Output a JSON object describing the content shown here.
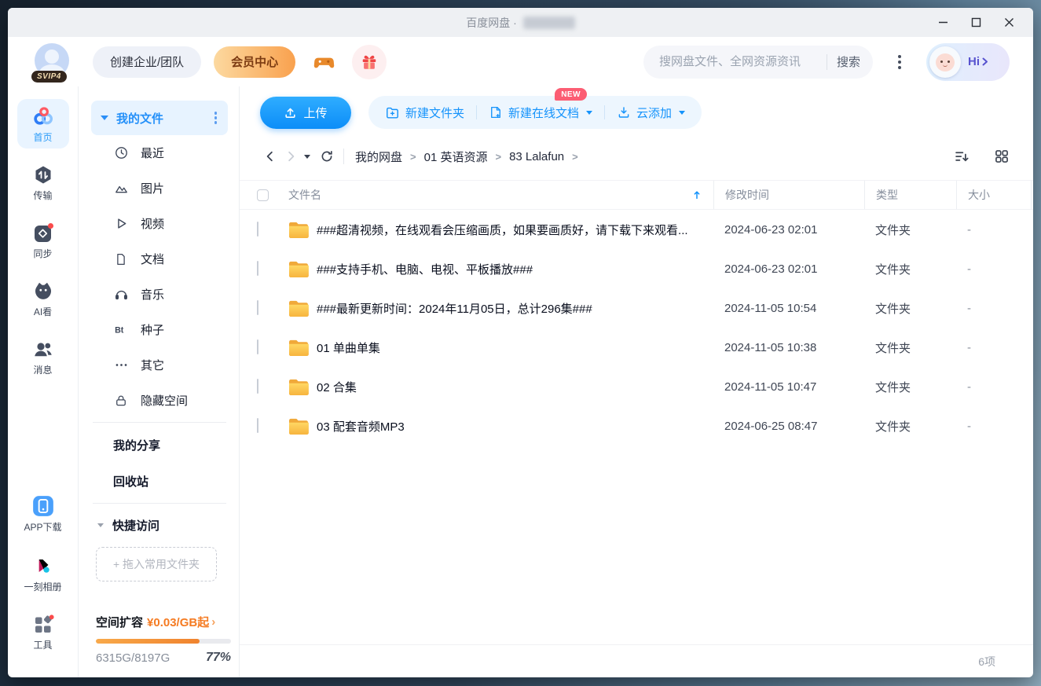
{
  "colors": {
    "accent": "#0f9bfb",
    "accent_light_bg": "#e9f4ff",
    "toolbar_group_bg": "#edf6fe",
    "orange": "#f57b22",
    "new_badge": "#fc5d73",
    "member_gradient_start": "#fcd9a0",
    "member_gradient_end": "#f9a14e",
    "folder_yellow": "#fbc64e"
  },
  "titlebar": {
    "title": "百度网盘 ·"
  },
  "header": {
    "vip_badge": "SVIP4",
    "create_team_label": "创建企业/团队",
    "member_center_label": "会员中心",
    "search_placeholder": "搜网盘文件、全网资源资讯",
    "search_button_label": "搜索",
    "greeting": "Hi"
  },
  "nav_rail": {
    "items": [
      {
        "label": "首页",
        "icon": "netdisk-logo-icon",
        "active": true
      },
      {
        "label": "传输",
        "icon": "transfer-icon"
      },
      {
        "label": "同步",
        "icon": "sync-icon"
      },
      {
        "label": "AI看",
        "icon": "ai-view-icon"
      },
      {
        "label": "消息",
        "icon": "messages-icon"
      }
    ],
    "bottom_items": [
      {
        "label": "APP下载",
        "icon": "app-download-icon"
      },
      {
        "label": "一刻相册",
        "icon": "photos-icon"
      },
      {
        "label": "工具",
        "icon": "tools-icon"
      }
    ]
  },
  "sidebar": {
    "my_files_label": "我的文件",
    "categories": [
      {
        "label": "最近",
        "icon": "clock-icon"
      },
      {
        "label": "图片",
        "icon": "photo-icon"
      },
      {
        "label": "视频",
        "icon": "video-icon"
      },
      {
        "label": "文档",
        "icon": "doc-icon"
      },
      {
        "label": "音乐",
        "icon": "music-icon"
      },
      {
        "label": "种子",
        "icon": "bt-icon"
      },
      {
        "label": "其它",
        "icon": "more-icon"
      },
      {
        "label": "隐藏空间",
        "icon": "lock-icon"
      }
    ],
    "my_share_label": "我的分享",
    "recycle_label": "回收站",
    "quick_access_label": "快捷访问",
    "drop_hint": "+ 拖入常用文件夹",
    "storage": {
      "expand_label": "空间扩容",
      "price_label": "¥0.03/GB起",
      "usage": "6315G/8197G",
      "percent_label": "77%",
      "percent_value": 77
    }
  },
  "toolbar": {
    "upload_label": "上传",
    "new_folder_label": "新建文件夹",
    "new_doc_label": "新建在线文档",
    "new_badge": "NEW",
    "cloud_add_label": "云添加"
  },
  "breadcrumb": {
    "separator": ">",
    "items": [
      {
        "label": "我的网盘"
      },
      {
        "label": "01 英语资源"
      },
      {
        "label": "83 Lalafun"
      }
    ]
  },
  "table": {
    "columns": {
      "name": "文件名",
      "modified": "修改时间",
      "type": "类型",
      "size": "大小"
    },
    "rows": [
      {
        "name": "###超清视频，在线观看会压缩画质，如果要画质好，请下载下来观看...",
        "modified": "2024-06-23 02:01",
        "type": "文件夹",
        "size": "-"
      },
      {
        "name": "###支持手机、电脑、电视、平板播放###",
        "modified": "2024-06-23 02:01",
        "type": "文件夹",
        "size": "-"
      },
      {
        "name": "###最新更新时间：2024年11月05日，总计296集###",
        "modified": "2024-11-05 10:54",
        "type": "文件夹",
        "size": "-"
      },
      {
        "name": "01 单曲单集",
        "modified": "2024-11-05 10:38",
        "type": "文件夹",
        "size": "-"
      },
      {
        "name": "02 合集",
        "modified": "2024-11-05 10:47",
        "type": "文件夹",
        "size": "-"
      },
      {
        "name": "03 配套音频MP3",
        "modified": "2024-06-25 08:47",
        "type": "文件夹",
        "size": "-"
      }
    ]
  },
  "footer": {
    "count_label": "6项"
  }
}
